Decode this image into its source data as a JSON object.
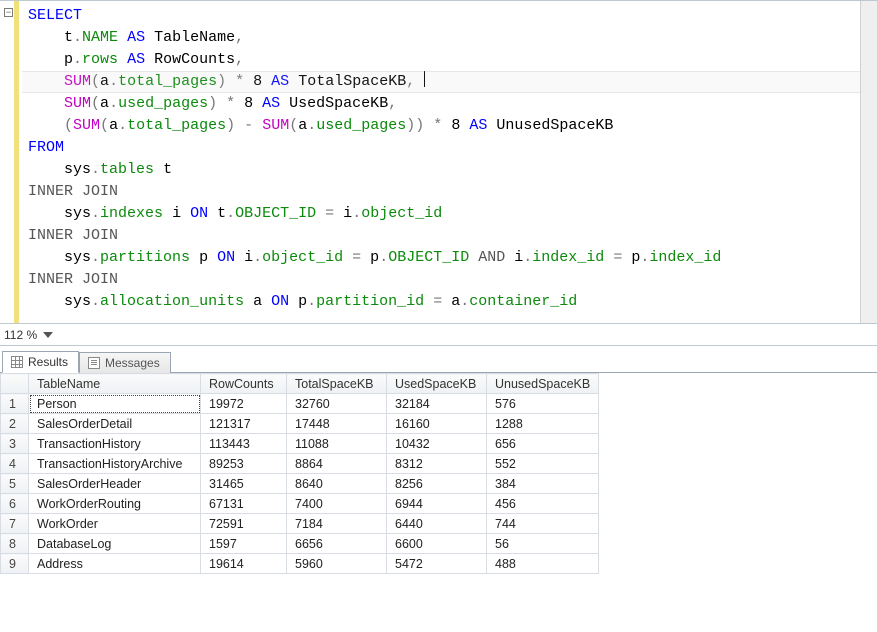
{
  "editor": {
    "zoom_label": "112 %",
    "fold_glyph": "−",
    "highlighted_line_index": 3,
    "lines": [
      [
        {
          "t": "SELECT",
          "c": "kw"
        }
      ],
      [
        {
          "t": "    "
        },
        {
          "t": "t",
          "c": "tok"
        },
        {
          "t": ".",
          "c": "op"
        },
        {
          "t": "NAME",
          "c": "obj"
        },
        {
          "t": " "
        },
        {
          "t": "AS",
          "c": "kw"
        },
        {
          "t": " TableName",
          "c": "tok"
        },
        {
          "t": ",",
          "c": "op"
        }
      ],
      [
        {
          "t": "    "
        },
        {
          "t": "p",
          "c": "tok"
        },
        {
          "t": ".",
          "c": "op"
        },
        {
          "t": "rows",
          "c": "obj"
        },
        {
          "t": " "
        },
        {
          "t": "AS",
          "c": "kw"
        },
        {
          "t": " RowCounts",
          "c": "tok"
        },
        {
          "t": ",",
          "c": "op"
        }
      ],
      [
        {
          "t": "    "
        },
        {
          "t": "SUM",
          "c": "fn"
        },
        {
          "t": "(",
          "c": "op"
        },
        {
          "t": "a",
          "c": "tok"
        },
        {
          "t": ".",
          "c": "op"
        },
        {
          "t": "total_pages",
          "c": "obj"
        },
        {
          "t": ")",
          "c": "op"
        },
        {
          "t": " ",
          "c": "op"
        },
        {
          "t": "*",
          "c": "op"
        },
        {
          "t": " 8 ",
          "c": "tok"
        },
        {
          "t": "AS",
          "c": "kw"
        },
        {
          "t": " TotalSpaceKB",
          "c": "tok"
        },
        {
          "t": ",",
          "c": "op"
        },
        {
          "t": " "
        },
        {
          "caret": true
        }
      ],
      [
        {
          "t": "    "
        },
        {
          "t": "SUM",
          "c": "fn"
        },
        {
          "t": "(",
          "c": "op"
        },
        {
          "t": "a",
          "c": "tok"
        },
        {
          "t": ".",
          "c": "op"
        },
        {
          "t": "used_pages",
          "c": "obj"
        },
        {
          "t": ")",
          "c": "op"
        },
        {
          "t": " ",
          "c": "op"
        },
        {
          "t": "*",
          "c": "op"
        },
        {
          "t": " 8 ",
          "c": "tok"
        },
        {
          "t": "AS",
          "c": "kw"
        },
        {
          "t": " UsedSpaceKB",
          "c": "tok"
        },
        {
          "t": ",",
          "c": "op"
        }
      ],
      [
        {
          "t": "    "
        },
        {
          "t": "(",
          "c": "op"
        },
        {
          "t": "SUM",
          "c": "fn"
        },
        {
          "t": "(",
          "c": "op"
        },
        {
          "t": "a",
          "c": "tok"
        },
        {
          "t": ".",
          "c": "op"
        },
        {
          "t": "total_pages",
          "c": "obj"
        },
        {
          "t": ")",
          "c": "op"
        },
        {
          "t": " ",
          "c": "op"
        },
        {
          "t": "-",
          "c": "op"
        },
        {
          "t": " "
        },
        {
          "t": "SUM",
          "c": "fn"
        },
        {
          "t": "(",
          "c": "op"
        },
        {
          "t": "a",
          "c": "tok"
        },
        {
          "t": ".",
          "c": "op"
        },
        {
          "t": "used_pages",
          "c": "obj"
        },
        {
          "t": "))",
          "c": "op"
        },
        {
          "t": " ",
          "c": "op"
        },
        {
          "t": "*",
          "c": "op"
        },
        {
          "t": " 8 ",
          "c": "tok"
        },
        {
          "t": "AS",
          "c": "kw"
        },
        {
          "t": " UnusedSpaceKB",
          "c": "tok"
        }
      ],
      [
        {
          "t": "FROM",
          "c": "kw"
        }
      ],
      [
        {
          "t": "    "
        },
        {
          "t": "sys",
          "c": "tok"
        },
        {
          "t": ".",
          "c": "op"
        },
        {
          "t": "tables",
          "c": "obj"
        },
        {
          "t": " t",
          "c": "tok"
        }
      ],
      [
        {
          "t": "INNER",
          "c": "dm"
        },
        {
          "t": " "
        },
        {
          "t": "JOIN",
          "c": "dm"
        }
      ],
      [
        {
          "t": "    "
        },
        {
          "t": "sys",
          "c": "tok"
        },
        {
          "t": ".",
          "c": "op"
        },
        {
          "t": "indexes",
          "c": "obj"
        },
        {
          "t": " i ",
          "c": "tok"
        },
        {
          "t": "ON",
          "c": "kw"
        },
        {
          "t": " t",
          "c": "tok"
        },
        {
          "t": ".",
          "c": "op"
        },
        {
          "t": "OBJECT_ID",
          "c": "obj"
        },
        {
          "t": " ",
          "c": "op"
        },
        {
          "t": "=",
          "c": "op"
        },
        {
          "t": " i",
          "c": "tok"
        },
        {
          "t": ".",
          "c": "op"
        },
        {
          "t": "object_id",
          "c": "obj"
        }
      ],
      [
        {
          "t": "INNER",
          "c": "dm"
        },
        {
          "t": " "
        },
        {
          "t": "JOIN",
          "c": "dm"
        }
      ],
      [
        {
          "t": "    "
        },
        {
          "t": "sys",
          "c": "tok"
        },
        {
          "t": ".",
          "c": "op"
        },
        {
          "t": "partitions",
          "c": "obj"
        },
        {
          "t": " p ",
          "c": "tok"
        },
        {
          "t": "ON",
          "c": "kw"
        },
        {
          "t": " i",
          "c": "tok"
        },
        {
          "t": ".",
          "c": "op"
        },
        {
          "t": "object_id",
          "c": "obj"
        },
        {
          "t": " ",
          "c": "op"
        },
        {
          "t": "=",
          "c": "op"
        },
        {
          "t": " p",
          "c": "tok"
        },
        {
          "t": ".",
          "c": "op"
        },
        {
          "t": "OBJECT_ID",
          "c": "obj"
        },
        {
          "t": " "
        },
        {
          "t": "AND",
          "c": "dm"
        },
        {
          "t": " i",
          "c": "tok"
        },
        {
          "t": ".",
          "c": "op"
        },
        {
          "t": "index_id",
          "c": "obj"
        },
        {
          "t": " ",
          "c": "op"
        },
        {
          "t": "=",
          "c": "op"
        },
        {
          "t": " p",
          "c": "tok"
        },
        {
          "t": ".",
          "c": "op"
        },
        {
          "t": "index_id",
          "c": "obj"
        }
      ],
      [
        {
          "t": "INNER",
          "c": "dm"
        },
        {
          "t": " "
        },
        {
          "t": "JOIN",
          "c": "dm"
        }
      ],
      [
        {
          "t": "    "
        },
        {
          "t": "sys",
          "c": "tok"
        },
        {
          "t": ".",
          "c": "op"
        },
        {
          "t": "allocation_units",
          "c": "obj"
        },
        {
          "t": " a ",
          "c": "tok"
        },
        {
          "t": "ON",
          "c": "kw"
        },
        {
          "t": " p",
          "c": "tok"
        },
        {
          "t": ".",
          "c": "op"
        },
        {
          "t": "partition_id",
          "c": "obj"
        },
        {
          "t": " ",
          "c": "op"
        },
        {
          "t": "=",
          "c": "op"
        },
        {
          "t": " a",
          "c": "tok"
        },
        {
          "t": ".",
          "c": "op"
        },
        {
          "t": "container_id",
          "c": "obj"
        }
      ]
    ]
  },
  "tabs": {
    "results_label": "Results",
    "messages_label": "Messages"
  },
  "results": {
    "columns": [
      "TableName",
      "RowCounts",
      "TotalSpaceKB",
      "UsedSpaceKB",
      "UnusedSpaceKB"
    ],
    "rows": [
      [
        "Person",
        "19972",
        "32760",
        "32184",
        "576"
      ],
      [
        "SalesOrderDetail",
        "121317",
        "17448",
        "16160",
        "1288"
      ],
      [
        "TransactionHistory",
        "113443",
        "11088",
        "10432",
        "656"
      ],
      [
        "TransactionHistoryArchive",
        "89253",
        "8864",
        "8312",
        "552"
      ],
      [
        "SalesOrderHeader",
        "31465",
        "8640",
        "8256",
        "384"
      ],
      [
        "WorkOrderRouting",
        "67131",
        "7400",
        "6944",
        "456"
      ],
      [
        "WorkOrder",
        "72591",
        "7184",
        "6440",
        "744"
      ],
      [
        "DatabaseLog",
        "1597",
        "6656",
        "6600",
        "56"
      ],
      [
        "Address",
        "19614",
        "5960",
        "5472",
        "488"
      ]
    ],
    "selected_row": 0,
    "selected_col": 0
  }
}
